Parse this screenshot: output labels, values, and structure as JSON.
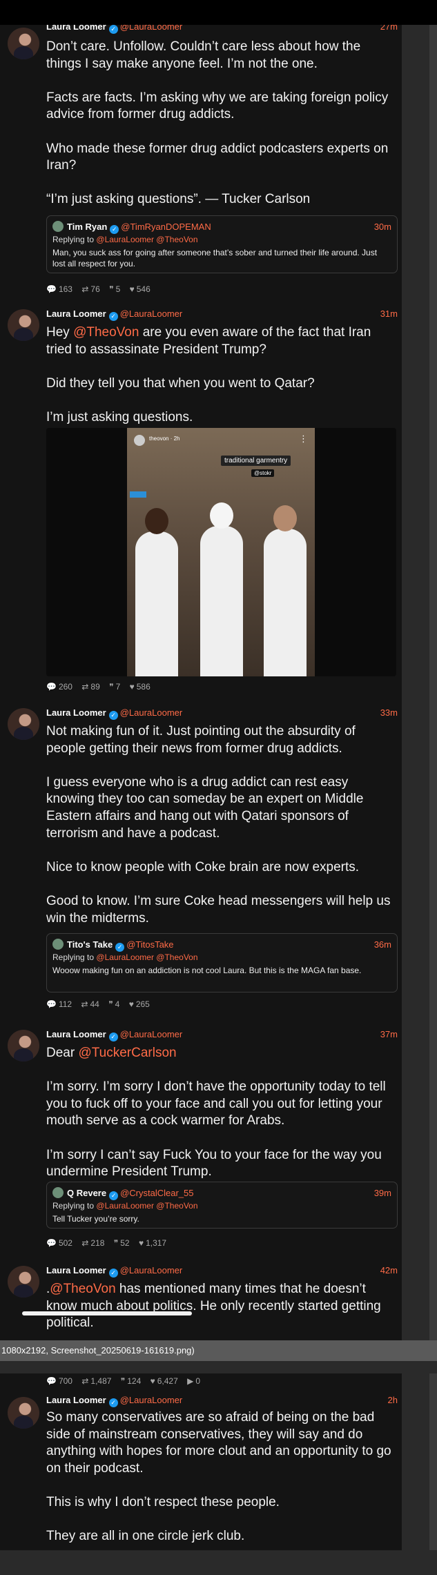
{
  "viewer": {
    "status_text": "1080x2192, Screenshot_20250619-161619.png)"
  },
  "tweets": [
    {
      "name": "Laura Loomer",
      "handle": "@LauraLoomer",
      "time": "27m",
      "paragraphs": [
        "Don’t care. Unfollow. Couldn’t care less about how the things I say make anyone feel. I’m not the one.",
        "Facts are facts. I’m asking why we are taking foreign policy advice from former drug addicts.",
        "Who made these former drug addict podcasters experts on Iran?",
        "“I’m just asking questions”. — Tucker Carlson"
      ],
      "quote": {
        "name": "Tim Ryan",
        "handle": "@TimRyanDOPEMAN",
        "time": "30m",
        "replying_label": "Replying to",
        "replying_to": "@LauraLoomer @TheoVon",
        "text": "Man, you suck ass for going after someone that’s sober and turned their life around. Just lost all respect for you."
      },
      "stats": {
        "replies": "163",
        "retweets": "76",
        "quotes": "5",
        "likes": "546"
      }
    },
    {
      "name": "Laura Loomer",
      "handle": "@LauraLoomer",
      "time": "31m",
      "text_parts": [
        "Hey ",
        "@TheoVon",
        " are you even aware of the fact that Iran tried to assassinate President Trump?"
      ],
      "paragraphs": [
        "Did they tell you that when you went to Qatar?",
        "I’m just asking questions."
      ],
      "media": {
        "ig_name": "theovon",
        "ig_time": "2h",
        "sticker": "traditional garmentry",
        "sticker_tag": "@stokr"
      },
      "stats": {
        "replies": "260",
        "retweets": "89",
        "quotes": "7",
        "likes": "586"
      }
    },
    {
      "name": "Laura Loomer",
      "handle": "@LauraLoomer",
      "time": "33m",
      "paragraphs": [
        "Not making fun of it. Just pointing out the absurdity of people getting their news from former drug addicts.",
        "I guess everyone who is a drug addict can rest easy knowing they too can someday be an expert on Middle Eastern affairs and hang out with Qatari sponsors of terrorism and have a podcast.",
        "Nice to know people with Coke brain are now experts.",
        "Good to know. I’m sure Coke head messengers will help us win the midterms."
      ],
      "quote": {
        "name": "Tito's Take",
        "handle": "@TitosTake",
        "time": "36m",
        "replying_label": "Replying to",
        "replying_to": "@LauraLoomer @TheoVon",
        "text": "Wooow making fun on an addiction is not cool Laura. But this is the MAGA fan base."
      },
      "stats": {
        "replies": "112",
        "retweets": "44",
        "quotes": "4",
        "likes": "265"
      }
    },
    {
      "name": "Laura Loomer",
      "handle": "@LauraLoomer",
      "time": "37m",
      "text_parts": [
        "Dear ",
        "@TuckerCarlson"
      ],
      "paragraphs": [
        "I’m sorry. I’m sorry I don’t have the opportunity today to tell you to fuck off to your face and call you out for letting your mouth serve as a cock warmer for Arabs.",
        "I’m sorry I can’t say Fuck You to your face for the way you undermine President Trump."
      ],
      "quote": {
        "name": "Q Revere",
        "handle": "@CrystalClear_55",
        "time": "39m",
        "replying_label": "Replying to",
        "replying_to": "@LauraLoomer @TheoVon",
        "text": "Tell Tucker you’re sorry."
      },
      "stats": {
        "replies": "502",
        "retweets": "218",
        "quotes": "52",
        "likes": "1,317"
      }
    },
    {
      "name": "Laura Loomer",
      "handle": "@LauraLoomer",
      "time": "42m",
      "text_parts": [
        ".",
        "@TheoVon",
        " has mentioned many times that he doesn’t know much about politics. He only recently started getting political."
      ],
      "stats": {
        "replies": "700",
        "retweets": "1,487",
        "quotes": "124",
        "likes": "6,427",
        "views": "0"
      }
    },
    {
      "name": "Laura Loomer",
      "handle": "@LauraLoomer",
      "time": "2h",
      "paragraphs": [
        "So many conservatives are so afraid of being on the bad side of mainstream conservatives, they will say and do anything with hopes for more clout and an opportunity to go on their podcast.",
        "This is why I don’t respect these people.",
        "They are all in one circle jerk club."
      ]
    }
  ]
}
